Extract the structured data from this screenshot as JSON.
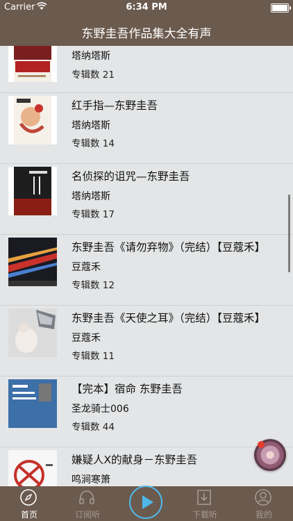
{
  "status": {
    "carrier": "Carrier",
    "time": "6:34 PM"
  },
  "nav": {
    "title": "东野圭吾作品集大全有声"
  },
  "items": [
    {
      "title": "",
      "author": "塔纳塔斯",
      "count": "专辑数 21"
    },
    {
      "title": "红手指—东野圭吾",
      "author": "塔纳塔斯",
      "count": "专辑数 14"
    },
    {
      "title": "名侦探的诅咒—东野圭吾",
      "author": "塔纳塔斯",
      "count": "专辑数 17"
    },
    {
      "title": "东野圭吾《请勿弃物》（完结）【豆蔻禾】",
      "author": "豆蔻禾",
      "count": "专辑数 12"
    },
    {
      "title": "东野圭吾《天使之耳》（完结）【豆蔻禾】",
      "author": "豆蔻禾",
      "count": "专辑数 11"
    },
    {
      "title": "【完本】宿命 东野圭吾",
      "author": "圣龙骑士006",
      "count": "专辑数 44"
    },
    {
      "title": "嫌疑人X的献身－东野圭吾",
      "author": "鸣涧寒箫",
      "count": ""
    }
  ],
  "tabs": [
    {
      "label": "首页",
      "icon": "compass-icon"
    },
    {
      "label": "订阅听",
      "icon": "headphones-icon"
    },
    {
      "label": "下载听",
      "icon": "download-icon"
    },
    {
      "label": "我的",
      "icon": "user-icon"
    }
  ],
  "colors": {
    "bar": "#6b5a4e",
    "play_accent": "#4fb8e8",
    "tab_inactive": "#a89a8f"
  }
}
